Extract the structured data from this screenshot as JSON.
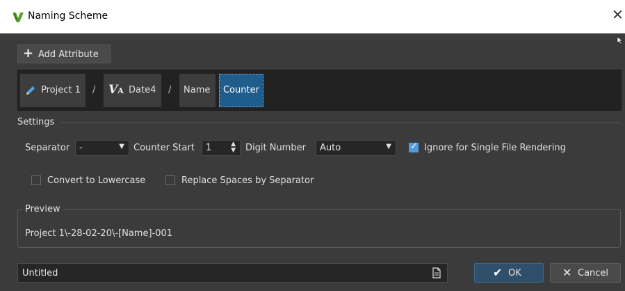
{
  "window": {
    "title": "Naming Scheme",
    "close_glyph": "✕",
    "app_icon": "wavelab-icon"
  },
  "toolbar": {
    "add_attribute_label": "Add Attribute"
  },
  "attributes": {
    "items": [
      {
        "label": "Project 1",
        "icon": "pencil-icon"
      },
      {
        "label": "Date4",
        "icon": "date-va-icon"
      },
      {
        "label": "Name"
      },
      {
        "label": "Counter",
        "selected": true
      }
    ],
    "separator": "/"
  },
  "settings": {
    "group_label": "Settings",
    "separator_label": "Separator",
    "separator_value": "-",
    "counter_start_label": "Counter Start",
    "counter_start_value": "1",
    "digit_number_label": "Digit Number",
    "digit_number_value": "Auto",
    "ignore_single_label": "Ignore for Single File Rendering",
    "ignore_single_checked": true,
    "lowercase_label": "Convert to Lowercase",
    "lowercase_checked": false,
    "replace_spaces_label": "Replace Spaces by Separator",
    "replace_spaces_checked": false
  },
  "preview": {
    "group_label": "Preview",
    "text": "Project 1\\-28-02-20\\-[Name]-001"
  },
  "footer": {
    "name_value": "Untitled",
    "ok_label": "OK",
    "cancel_label": "Cancel"
  },
  "colors": {
    "selected_chip": "#1f5d8d",
    "checkbox_on": "#4f9ae0",
    "ok_button": "#2f4f6a"
  }
}
